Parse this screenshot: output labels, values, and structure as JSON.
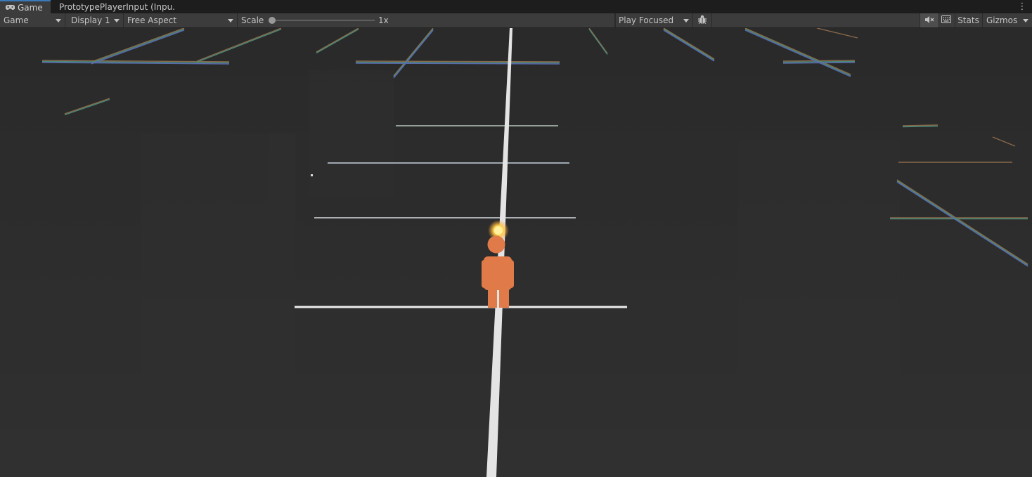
{
  "tabs": [
    {
      "label": "Game",
      "icon": "gamepad-icon",
      "active": true
    },
    {
      "label": "PrototypePlayerInput (Inpu...",
      "active": false
    }
  ],
  "toolbar": {
    "view_mode": "Game",
    "display": "Display 1",
    "aspect": "Free Aspect",
    "scale_label": "Scale",
    "scale_value": "1x",
    "scale_fraction": 0.0,
    "play_mode": "Play Focused",
    "stats_label": "Stats",
    "gizmos_label": "Gizmos"
  },
  "icons": [
    "gamepad-icon",
    "bug-icon",
    "mute-audio-icon",
    "keyboard-icon",
    "kebab-menu-icon",
    "dropdown-caret-icon"
  ],
  "colors": {
    "background": "#2d2d2d",
    "player": "#e07a48",
    "glow": "#ffd76a",
    "line": "#e6e6e6"
  }
}
